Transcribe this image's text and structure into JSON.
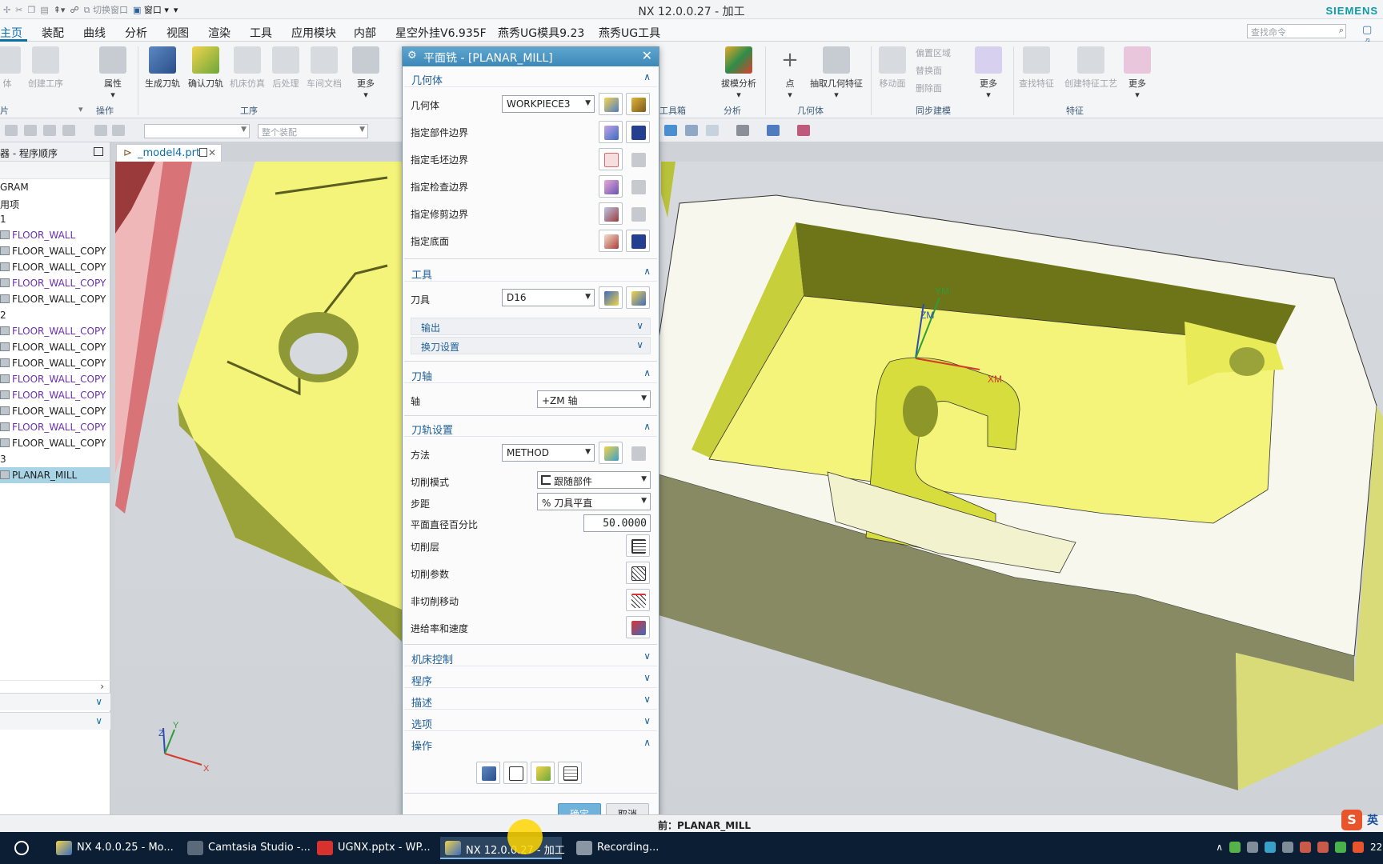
{
  "app": {
    "title": "NX 12.0.0.27 - 加工",
    "brand": "SIEMENS",
    "quick_access": {
      "switch_window": "切换窗口",
      "window": "窗口"
    }
  },
  "menu_tabs": [
    "主页",
    "装配",
    "曲线",
    "分析",
    "视图",
    "渲染",
    "工具",
    "应用模块",
    "内部",
    "星空外挂V6.935F",
    "燕秀UG模具9.23",
    "燕秀UG工具"
  ],
  "search": {
    "placeholder": "查找命令"
  },
  "ribbon": {
    "buttons": {
      "create_tool": "创建工序",
      "properties": "属性",
      "generate_path": "生成刀轨",
      "verify_path": "确认刀轨",
      "machine_sim": "机床仿真",
      "postprocess": "后处理",
      "shop_doc": "车间文档",
      "more1": "更多",
      "draft_analysis": "拔模分析",
      "point": "点",
      "extract_geometry": "抽取几何特征",
      "move_face": "移动面",
      "more2": "更多",
      "find_features": "查找特征",
      "create_feature_process": "创建特征工艺",
      "more3": "更多",
      "sync_small_1": "偏置区域",
      "sync_small_2": "替换面",
      "sync_small_3": "删除面"
    },
    "groups": {
      "g1": "片",
      "operation": "操作",
      "process": "工序",
      "toolbox": "工具箱",
      "analysis": "分析",
      "geometry": "几何体",
      "sync_modeling": "同步建模",
      "feature": "特征"
    }
  },
  "toolbar2": {
    "combo2_placeholder": "整个装配"
  },
  "navigator": {
    "title": "器 - 程序顺序",
    "rows": [
      {
        "label": "GRAM",
        "style": "plain"
      },
      {
        "label": "用项",
        "style": "plain"
      },
      {
        "label": "1",
        "style": "plain"
      },
      {
        "label": "FLOOR_WALL",
        "style": "purple"
      },
      {
        "label": "FLOOR_WALL_COPY",
        "style": "normal"
      },
      {
        "label": "FLOOR_WALL_COPY",
        "style": "normal"
      },
      {
        "label": "FLOOR_WALL_COPY",
        "style": "purple"
      },
      {
        "label": "FLOOR_WALL_COPY",
        "style": "normal"
      },
      {
        "label": "2",
        "style": "plain"
      },
      {
        "label": "FLOOR_WALL_COPY",
        "style": "purple"
      },
      {
        "label": "FLOOR_WALL_COPY",
        "style": "normal"
      },
      {
        "label": "FLOOR_WALL_COPY",
        "style": "normal"
      },
      {
        "label": "FLOOR_WALL_COPY",
        "style": "purple"
      },
      {
        "label": "FLOOR_WALL_COPY",
        "style": "purple"
      },
      {
        "label": "FLOOR_WALL_COPY",
        "style": "normal"
      },
      {
        "label": "FLOOR_WALL_COPY",
        "style": "purple"
      },
      {
        "label": "FLOOR_WALL_COPY",
        "style": "normal"
      },
      {
        "label": "3",
        "style": "plain"
      },
      {
        "label": "PLANAR_MILL",
        "style": "selected"
      }
    ]
  },
  "doc_tab": {
    "name": "_model4.prt"
  },
  "viewport": {
    "axis_labels": {
      "ym": "YM",
      "zm": "ZM",
      "xm": "XM",
      "x": "X",
      "y": "Y",
      "z": "Z"
    }
  },
  "dialog": {
    "title": "平面铣 - [PLANAR_MILL]",
    "sections": {
      "geometry": {
        "header": "几何体",
        "geometry_label": "几何体",
        "geometry_value": "WORKPIECE3",
        "rows": [
          "指定部件边界",
          "指定毛坯边界",
          "指定检查边界",
          "指定修剪边界",
          "指定底面"
        ]
      },
      "tool": {
        "header": "工具",
        "tool_label": "刀具",
        "tool_value": "D16",
        "output": "输出",
        "tool_change": "换刀设置"
      },
      "axis": {
        "header": "刀轴",
        "axis_label": "轴",
        "axis_value": "+ZM 轴"
      },
      "path": {
        "header": "刀轨设置",
        "method_label": "方法",
        "method_value": "METHOD",
        "cut_mode_label": "切削模式",
        "cut_mode_value": "跟随部件",
        "stepover_label": "步距",
        "stepover_value": "% 刀具平直",
        "flat_pct_label": "平面直径百分比",
        "flat_pct_value": "50.0000",
        "cut_levels": "切削层",
        "cut_params": "切削参数",
        "non_cut_moves": "非切削移动",
        "feeds_speeds": "进给率和速度"
      },
      "machine_control": "机床控制",
      "program": "程序",
      "description": "描述",
      "options": "选项",
      "actions": "操作"
    },
    "ok": "确定",
    "cancel": "取消"
  },
  "status": {
    "message": "前：PLANAR_MILL"
  },
  "ime": {
    "lang": "英"
  },
  "taskbar": {
    "items": [
      "NX 4.0.0.25 - Mo...",
      "Camtasia Studio -...",
      "UGNX.pptx - WP...",
      "NX 12.0.0.27 - 加工",
      "Recording..."
    ],
    "time": "22"
  },
  "colors": {
    "accent": "#0d6ea8",
    "dialog_title": "#3d88b8",
    "part_yellow": "#f4f47a",
    "part_wall": "#b8c23a",
    "part_outer": "#f7f7ee",
    "selection": "#a8d4e6",
    "taskbar": "#0c1e33"
  }
}
